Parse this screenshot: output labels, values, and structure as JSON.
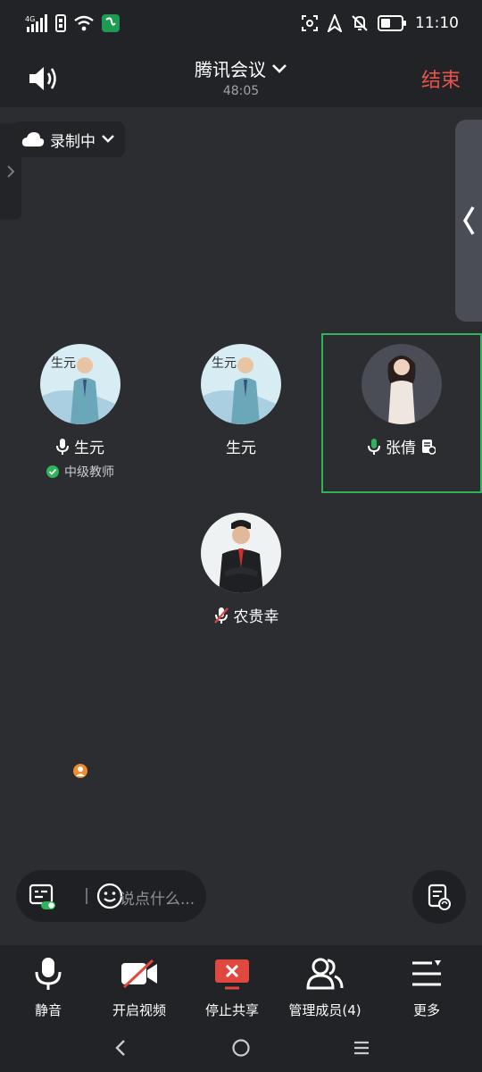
{
  "status_bar": {
    "network": "4G",
    "time": "11:10",
    "icons": [
      "signal-icon",
      "sim-icon",
      "wifi-icon",
      "app-icon",
      "screenshot-icon",
      "location-icon",
      "bell-off-icon",
      "battery-icon"
    ]
  },
  "header": {
    "title": "腾讯会议",
    "timer": "48:05",
    "end_label": "结束"
  },
  "recording": {
    "label": "录制中"
  },
  "participants": [
    {
      "name": "生元",
      "subtitle": "中级教师",
      "mic": "on",
      "host": true
    },
    {
      "name": "生元",
      "subtitle": "",
      "mic": "none",
      "host": false
    },
    {
      "name": "张倩",
      "subtitle": "",
      "mic": "active",
      "host": false,
      "highlighted": true
    },
    {
      "name": "农贵幸",
      "subtitle": "",
      "mic": "muted",
      "host": false
    }
  ],
  "chat": {
    "placeholder": "说点什么..."
  },
  "toolbar": {
    "mute": "静音",
    "video": "开启视频",
    "share": "停止共享",
    "members": "管理成员(4)",
    "more": "更多"
  },
  "colors": {
    "accent_green": "#2fb45a",
    "end_red": "#e8524a",
    "share_red": "#e0473f",
    "host_orange": "#f08a2a",
    "background": "#2b2d31"
  }
}
